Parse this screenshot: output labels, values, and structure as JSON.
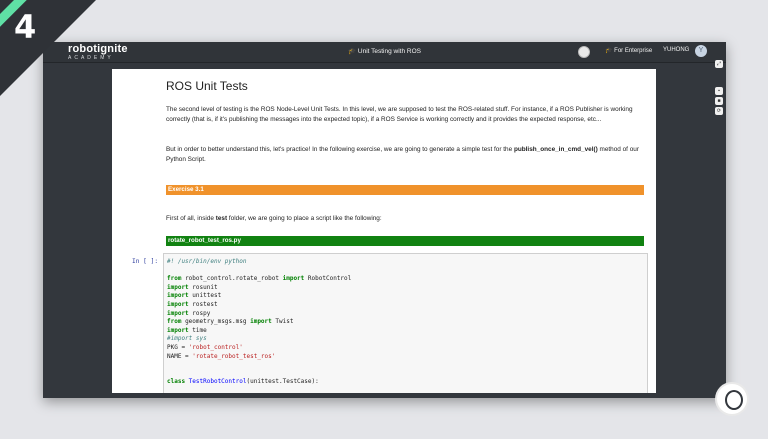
{
  "overlay": {
    "step_number": "4"
  },
  "window": {
    "logo_main": "robotignite",
    "logo_sub": "ACADEMY",
    "title": "Unit Testing with ROS",
    "enterprise_label": "For Enterprise",
    "username": "YUHONG",
    "user_initial": "Y"
  },
  "notebook": {
    "heading": "ROS Unit Tests",
    "para1": "The second level of testing is the ROS Node-Level Unit Tests. In this level, we are supposed to test the ROS-related stuff. For instance, if a ROS Publisher is working correctly (that is, if it's publishing the messages into the expected topic), if a ROS Service is working correctly and it provides the expected response, etc...",
    "para2_part1": "But in order to better understand this, let's practice! In the following exercise, we are going to generate a simple test for the ",
    "para2_bold": "publish_once_in_cmd_vel()",
    "para2_part2": " method of our Python Script.",
    "exercise_label": "Exercise 3.1",
    "para3_part1": "First of all, inside ",
    "para3_bold": "test",
    "para3_part2": " folder, we are going to place a script like the following:",
    "script_name": "rotate_robot_test_ros.py",
    "prompt": "In [ ]:",
    "code": {
      "l1": "#! /usr/bin/env python",
      "l3a": "from",
      "l3b": " robot_control.rotate_robot ",
      "l3c": "import",
      "l3d": " RobotControl",
      "l4a": "import",
      "l4b": " rosunit",
      "l5a": "import",
      "l5b": " unittest",
      "l6a": "import",
      "l6b": " rostest",
      "l7a": "import",
      "l7b": " rospy",
      "l8a": "from",
      "l8b": " geometry_msgs.msg ",
      "l8c": "import",
      "l8d": " Twist",
      "l9a": "import",
      "l9b": " time",
      "l10": "#import sys",
      "l11a": "PKG = ",
      "l11b": "'robot_control'",
      "l12a": "NAME = ",
      "l12b": "'rotate_robot_test_ros'",
      "l15a": "class",
      "l15b": " TestRobotControl",
      "l15c": "(unittest.TestCase):"
    }
  },
  "colors": {
    "exercise_bar": "#f0922b",
    "script_bar": "#118211",
    "corner_stripe": "#5fe0a5"
  }
}
